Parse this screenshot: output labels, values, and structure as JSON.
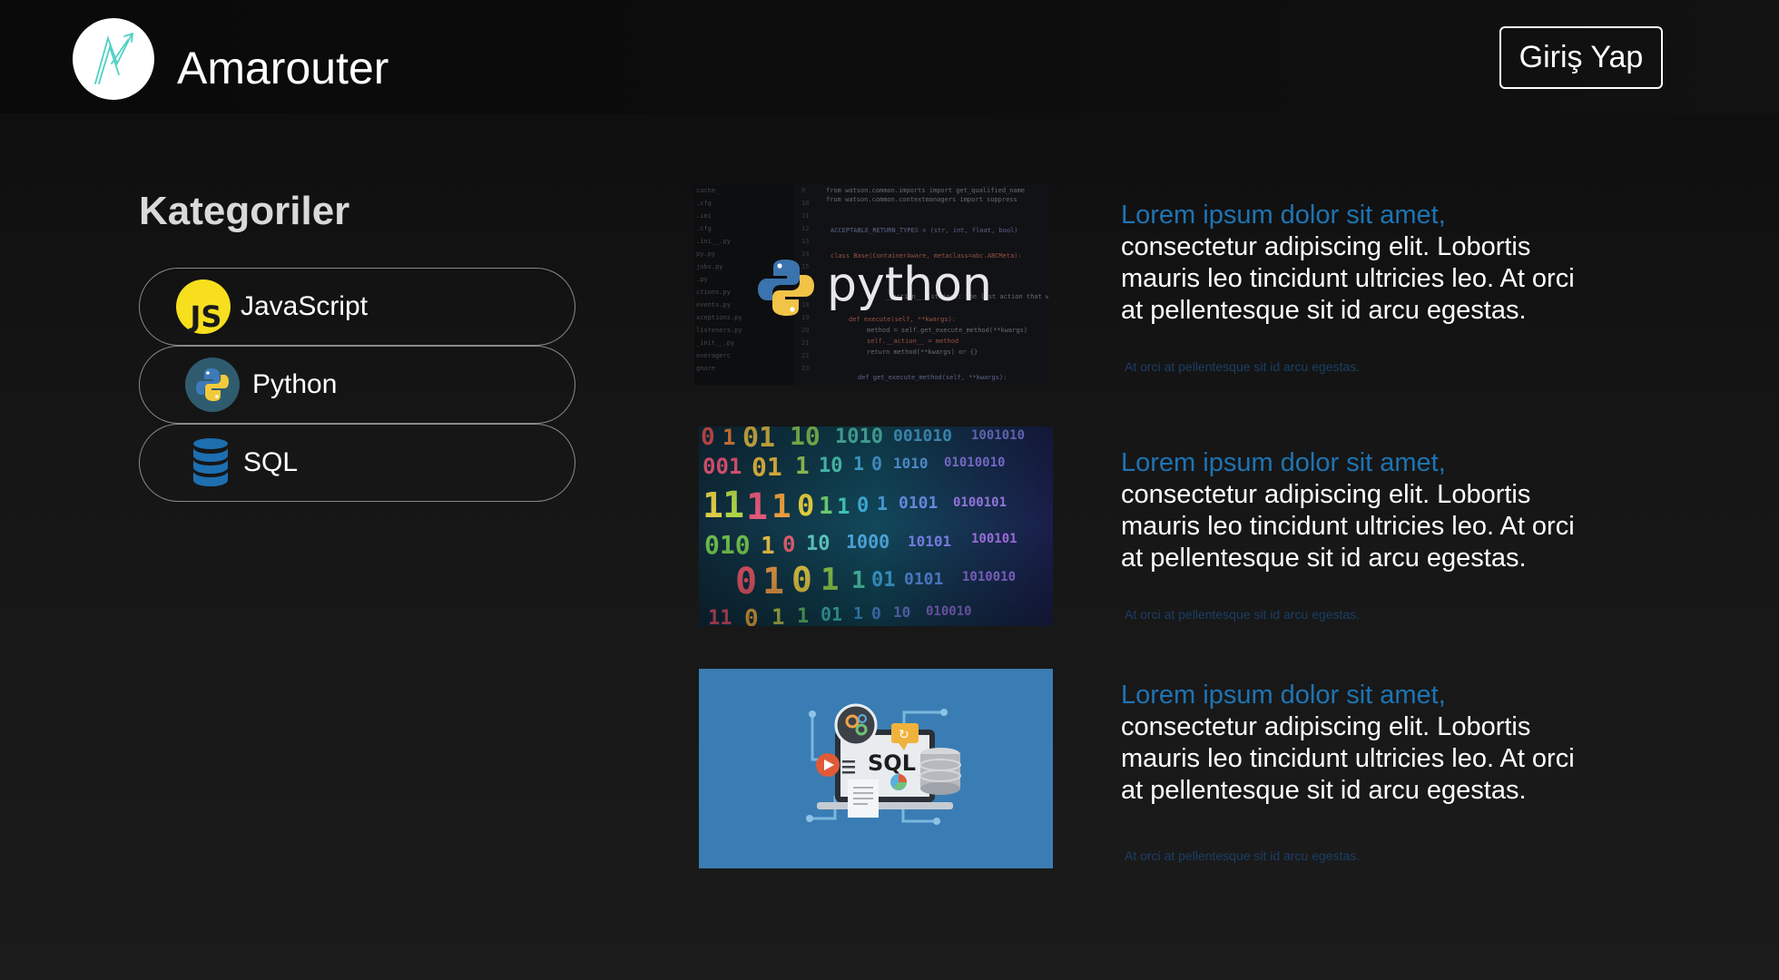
{
  "header": {
    "brand": "Amarouter",
    "login_label": "Giriş Yap"
  },
  "sidebar": {
    "title": "Kategoriler",
    "items": [
      {
        "label": "JavaScript",
        "icon": "javascript-icon"
      },
      {
        "label": "Python",
        "icon": "python-icon"
      },
      {
        "label": "SQL",
        "icon": "database-icon"
      }
    ]
  },
  "articles": [
    {
      "image": "python-code-image",
      "image_text": "python",
      "lead": "Lorem ipsum dolor sit amet,",
      "body": "consectetur adipiscing elit. Lobortis mauris leo tincidunt ultricies leo. At orci at pellentesque sit id arcu egestas.",
      "meta": "At orci at pellentesque sit id arcu egestas."
    },
    {
      "image": "binary-code-image",
      "lead": "Lorem ipsum dolor sit amet,",
      "body": "consectetur adipiscing elit. Lobortis mauris leo tincidunt ultricies leo. At orci at pellentesque sit id arcu egestas.",
      "meta": "At orci at pellentesque sit id arcu egestas."
    },
    {
      "image": "sql-illustration-image",
      "image_text": "SQL",
      "lead": "Lorem ipsum dolor sit amet,",
      "body": "consectetur adipiscing elit. Lobortis mauris leo tincidunt ultricies leo. At orci at pellentesque sit id arcu egestas.",
      "meta": "At orci at pellentesque sit id arcu egestas."
    }
  ],
  "colors": {
    "accent": "#1e74b3",
    "meta": "#1b3f66",
    "js_yellow": "#f7df1e",
    "sql_blue": "#3a7db4"
  }
}
